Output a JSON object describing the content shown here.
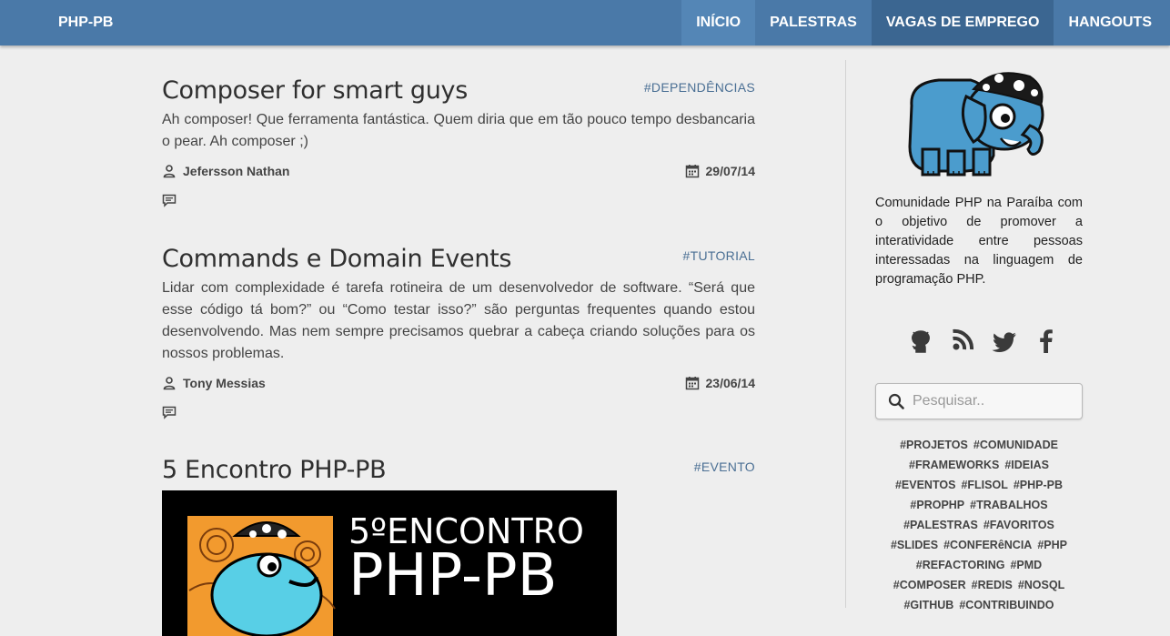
{
  "navbar": {
    "brand": "PHP-PB",
    "items": [
      {
        "label": "INÍCIO"
      },
      {
        "label": "PALESTRAS"
      },
      {
        "label": "VAGAS DE EMPREGO"
      },
      {
        "label": "HANGOUTS"
      }
    ]
  },
  "posts": [
    {
      "title": "Composer for smart guys",
      "tag": "#DEPENDÊNCIAS",
      "excerpt": "Ah composer! Que ferramenta fantástica. Quem diria que em tão pouco tempo desbancaria o pear. Ah composer ;)",
      "author": "Jefersson Nathan",
      "date": "29/07/14"
    },
    {
      "title": "Commands e Domain Events",
      "tag": "#TUTORIAL",
      "excerpt": "Lidar com complexidade é tarefa rotineira de um desenvolvedor de software. “Será que esse código tá bom?” ou “Como testar isso?” são perguntas frequentes quando estou desenvolvendo. Mas nem sempre precisamos quebrar a cabeça criando soluções para os nossos problemas.",
      "author": "Tony Messias",
      "date": "23/06/14"
    },
    {
      "title": "5 Encontro PHP-PB",
      "tag": "#EVENTO",
      "banner_line1": "5ºENCONTRO",
      "banner_line2": "PHP-PB"
    }
  ],
  "sidebar": {
    "about": "Comunidade PHP na Paraíba com o objetivo de promover a interatividade entre pessoas interessadas na linguagem de programação PHP.",
    "social": [
      "github-icon",
      "rss-icon",
      "twitter-icon",
      "facebook-icon"
    ],
    "search_placeholder": "Pesquisar..",
    "tags": [
      "#PROJETOS",
      "#COMUNIDADE",
      "#FRAMEWORKS",
      "#IDEIAS",
      "#EVENTOS",
      "#FLISOL",
      "#PHP-PB",
      "#PROPHP",
      "#TRABALHOS",
      "#PALESTRAS",
      "#FAVORITOS",
      "#SLIDES",
      "#CONFERêNCIA",
      "#PHP",
      "#REFACTORING",
      "#PMD",
      "#COMPOSER",
      "#REDIS",
      "#NOSQL",
      "#GITHUB",
      "#CONTRIBUINDO"
    ]
  },
  "colors": {
    "navbar": "#4a79a8",
    "nav_active": "#5486b6",
    "nav_dark": "#3b6691",
    "tag": "#4a6f94",
    "elephant": "#4b9ccd"
  }
}
